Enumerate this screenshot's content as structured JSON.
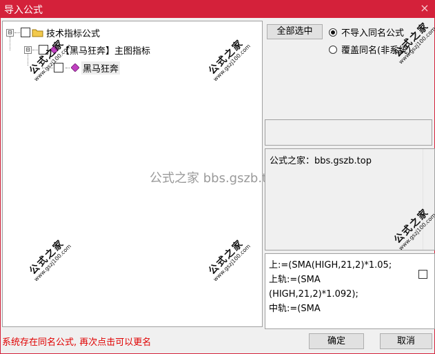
{
  "window": {
    "title": "导入公式",
    "close_glyph": "×"
  },
  "tree": {
    "root": {
      "expander": "⊟",
      "label": "技术指标公式"
    },
    "group": {
      "expander": "⊟",
      "label": "【黑马狂奔】主图指标"
    },
    "item": {
      "label": "黑马狂奔"
    }
  },
  "buttons": {
    "select_all": "全部选中",
    "ok": "确定",
    "cancel": "取消"
  },
  "options": {
    "skip_same_name": "不导入同名公式",
    "overwrite_same_name": "覆盖同名(非系统)",
    "selected": "skip_same_name"
  },
  "description": "公式之家：bbs.gszb.top",
  "code_lines": [
    "上:=(SMA(HIGH,21,2)*1.05;",
    "上轨:=(SMA",
    "(HIGH,21,2)*1.092);",
    "中轨:=(SMA"
  ],
  "status_message": "系统存在同名公式, 再次点击可以更名",
  "watermarks": {
    "main_text": "公式之家",
    "url_text": "www.gszj100.com",
    "center_text": "公式之家 bbs.gszb.top"
  },
  "colors": {
    "titlebar": "#d4213a",
    "status_text": "#e00000",
    "folder": "#f2c94c",
    "diamond": "#c040c0"
  }
}
